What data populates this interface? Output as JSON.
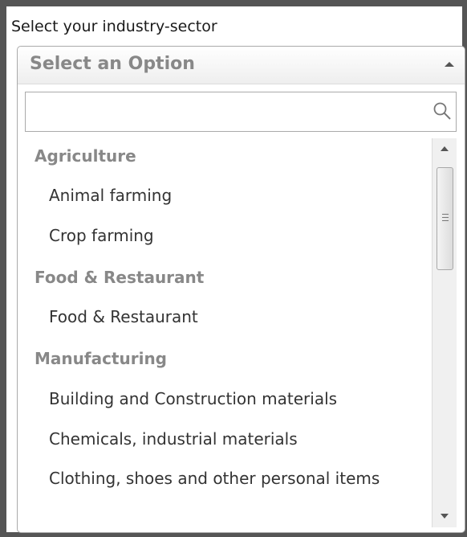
{
  "field": {
    "label": "Select your industry-sector"
  },
  "select": {
    "selected_text": "Select an Option",
    "search_value": "",
    "search_placeholder": ""
  },
  "groups": [
    {
      "label": "Agriculture",
      "options": [
        "Animal farming",
        "Crop farming"
      ]
    },
    {
      "label": "Food & Restaurant",
      "options": [
        "Food & Restaurant"
      ]
    },
    {
      "label": "Manufacturing",
      "options": [
        "Building and Construction materials",
        "Chemicals, industrial materials",
        "Clothing, shoes and other personal items"
      ]
    }
  ],
  "scrollbar": {
    "position_fraction": 0.0
  },
  "colors": {
    "frame_border": "#555555",
    "group_text": "#888888",
    "option_text": "#333333",
    "placeholder_text": "#888888"
  },
  "icons": {
    "dropdown_arrow": "triangle-up-icon",
    "search": "magnifier-icon",
    "scroll_up": "triangle-up-icon",
    "scroll_down": "triangle-down-icon",
    "thumb_grip": "grip-lines-icon"
  }
}
